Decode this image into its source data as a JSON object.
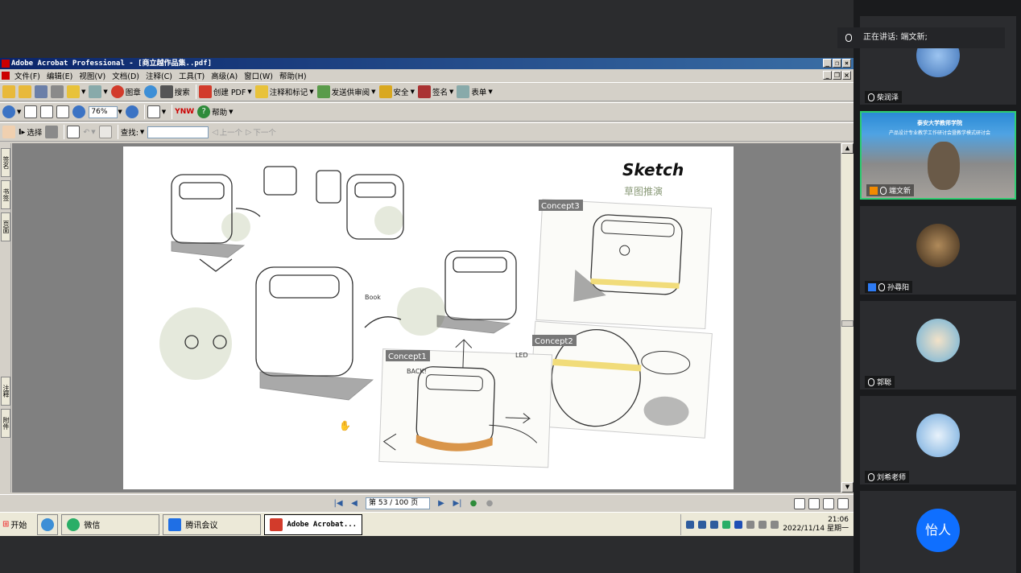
{
  "app": {
    "title": "Adobe Acrobat Professional - [商立越作品集..pdf]",
    "window_buttons": [
      "_",
      "❐",
      "×"
    ]
  },
  "menu": [
    "文件(F)",
    "编辑(E)",
    "视图(V)",
    "文档(D)",
    "注释(C)",
    "工具(T)",
    "高级(A)",
    "窗口(W)",
    "帮助(H)"
  ],
  "toolbar1": {
    "stamp": "图章",
    "search": "搜索",
    "create_pdf": "创建 PDF",
    "comment": "注释和标记",
    "send_review": "发送供审阅",
    "security": "安全",
    "sign": "签名",
    "forms": "表单"
  },
  "toolbar2": {
    "zoom": "76%",
    "ynw": "YNW",
    "help": "帮助"
  },
  "toolbar3": {
    "select": "选择",
    "find_label": "查找:",
    "find_value": "",
    "prev": "上一个",
    "next": "下一个"
  },
  "side_tabs": [
    "签名",
    "书签",
    "页面",
    "注释",
    "附件"
  ],
  "document": {
    "heading": "Sketch",
    "subheading": "草图推演",
    "concept_labels": [
      "Concept3",
      "Concept2",
      "Concept1"
    ],
    "notes": [
      "Book",
      "BACK!",
      "LED"
    ]
  },
  "status": {
    "page": "第 53 / 100 页"
  },
  "taskbar": {
    "start": "开始",
    "tasks": [
      "微信",
      "腾讯会议",
      "Adobe Acrobat..."
    ],
    "time": "21:06",
    "date": "2022/11/14 星期一"
  },
  "meeting": {
    "speaking": "正在讲话: 端文新;",
    "participants": [
      {
        "name": "柴润泽"
      },
      {
        "name": "端文新"
      },
      {
        "name": "孙尋阳"
      },
      {
        "name": "郭聪"
      },
      {
        "name": "刘希老师"
      },
      {
        "name": "怡人",
        "avatar_text": "怡人"
      }
    ],
    "video_banner_top": "泰安大学教师学院",
    "video_banner": "产品设计专业教学工作研讨会暨教学模式研讨会"
  },
  "colors": {
    "title_gradient_start": "#0a246a",
    "title_gradient_end": "#3a6ea5",
    "chrome": "#d4d0c8",
    "meeting_bg": "#1a1b1d",
    "accent_blue": "#0f6fff"
  }
}
